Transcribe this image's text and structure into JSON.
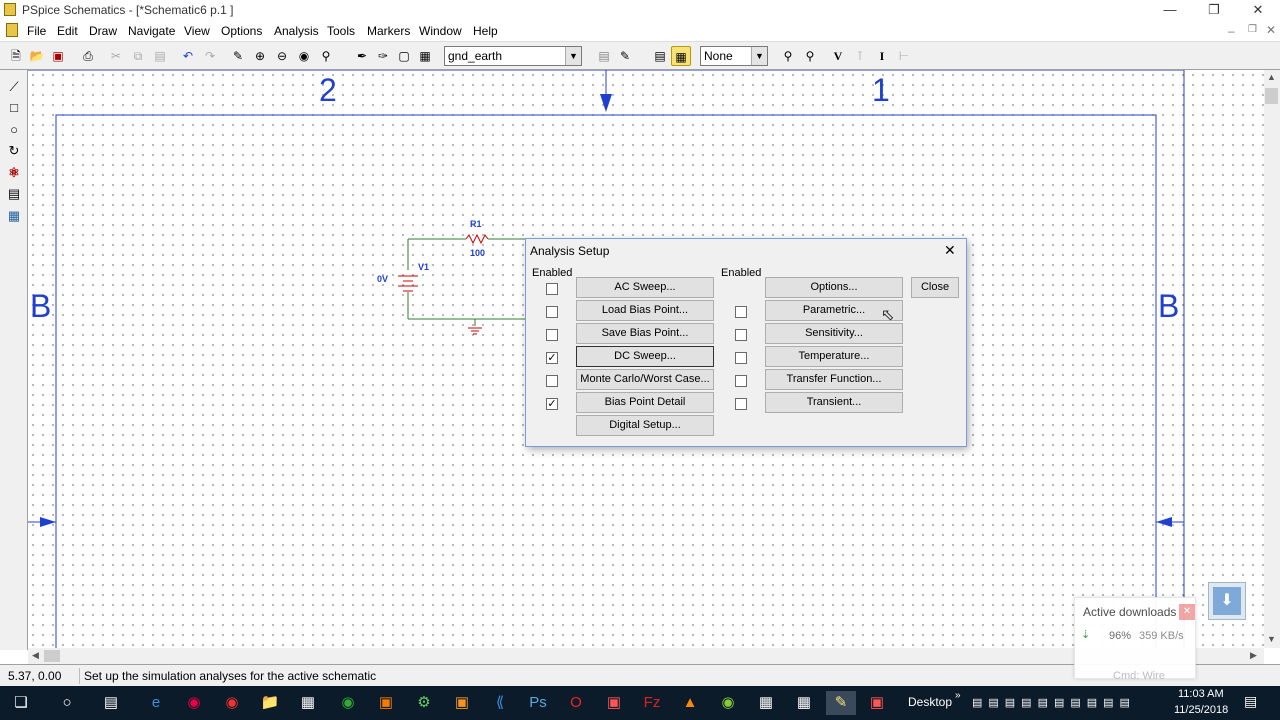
{
  "window": {
    "title": "PSpice Schematics - [*Schematic6  p.1 ]"
  },
  "menus": [
    "File",
    "Edit",
    "Draw",
    "Navigate",
    "View",
    "Options",
    "Analysis",
    "Tools",
    "Markers",
    "Window",
    "Help"
  ],
  "toolbar": {
    "part_combo": "gnd_earth",
    "none_combo": "None"
  },
  "schematic": {
    "zone_left": "2",
    "zone_right": "1",
    "border_b_left": "B",
    "border_b_right": "B",
    "r1_name": "R1",
    "r1_value": "100",
    "v1_name": "V1",
    "v1_value": "0V"
  },
  "dialog": {
    "title": "Analysis Setup",
    "enabled_label_left": "Enabled",
    "enabled_label_right": "Enabled",
    "close_label": "Close",
    "left_buttons": [
      {
        "label": "AC Sweep...",
        "checked": false
      },
      {
        "label": "Load Bias Point...",
        "checked": false
      },
      {
        "label": "Save Bias Point...",
        "checked": false
      },
      {
        "label": "DC Sweep...",
        "checked": true
      },
      {
        "label": "Monte Carlo/Worst Case...",
        "checked": false
      },
      {
        "label": "Bias Point Detail",
        "checked": true
      },
      {
        "label": "Digital Setup...",
        "checked": null
      }
    ],
    "right_buttons": [
      {
        "label": "Options...",
        "checked": null
      },
      {
        "label": "Parametric...",
        "checked": false
      },
      {
        "label": "Sensitivity...",
        "checked": false
      },
      {
        "label": "Temperature...",
        "checked": false
      },
      {
        "label": "Transfer Function...",
        "checked": false
      },
      {
        "label": "Transient...",
        "checked": false
      }
    ]
  },
  "status": {
    "coords": "5.37, 0.00",
    "message": "Set up the simulation analyses for the active schematic"
  },
  "downloads": {
    "title": "Active downloads",
    "percent": "96%",
    "speed": "359 KB/s",
    "cmd": "Cmd: Wire"
  },
  "taskbar": {
    "desktop_label": "Desktop",
    "time": "11:03 AM",
    "date": "11/25/2018"
  },
  "colors": {
    "accent_blue": "#1f3fd0",
    "wire_green": "#2e7d2e",
    "taskbar": "#0c1b2a"
  }
}
